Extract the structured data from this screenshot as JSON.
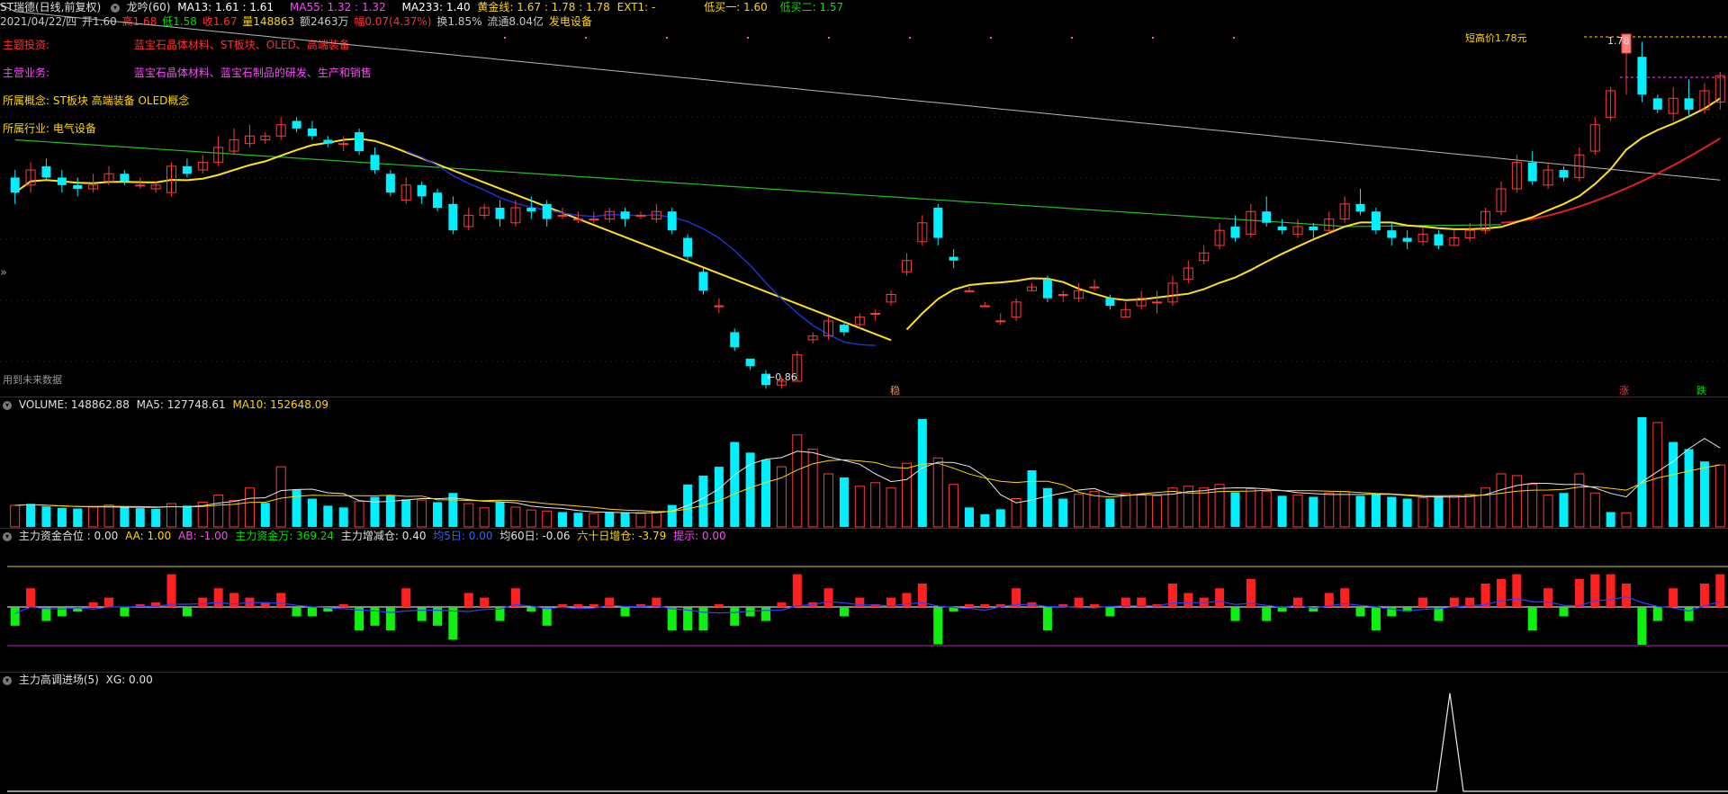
{
  "header": {
    "stock": "ST瑞德(日线,前复权)",
    "indicator": "龙吟(60)",
    "ma13": "MA13: 1.61 : 1.61",
    "ma55": "MA55: 1.32 : 1.32",
    "ma233": "MA233: 1.40",
    "golden_line": "黄金线: 1.67 : 1.78 : 1.78",
    "ext1": "EXT1: -",
    "low_buy1": "低买一: 1.60",
    "low_buy2": "低买二: 1.57",
    "colors": {
      "ma13": "#ffffff",
      "ma55": "#ff44ff",
      "ma233": "#ffffff",
      "golden": "#ffd700",
      "low": "#00e000"
    }
  },
  "quote": {
    "date": "2021/04/22/四",
    "open": "开1.60",
    "high": "高1.68",
    "low": "低1.58",
    "close": "收1.67",
    "volume": "量148863",
    "amount": "额2463万",
    "change": "幅0.07(4.37%)",
    "turnover": "换1.85%",
    "float": "流通8.04亿",
    "industry": "发电设备"
  },
  "info_panel": {
    "theme_label": "主题投资:",
    "theme_value": "蓝宝石晶体材料、ST板块、OLED、高端装备",
    "business_label": "主营业务:",
    "business_value": "蓝宝石晶体材料、蓝宝石制品的研发、生产和销售",
    "concept_label": "所属概念:",
    "concept_value": "ST板块 高端装备 OLED概念",
    "industry_label": "所属行业:",
    "industry_value": "电气设备",
    "top_right_note": "短高价1.78元"
  },
  "chart_labels": {
    "future_data": "用到未来数据",
    "low_price": "←0.86",
    "high_price": "1.78",
    "marker_stable": "稳",
    "marker_up": "涨",
    "marker_down": "跌",
    "collapse": "»"
  },
  "volume_panel": {
    "volume": "VOLUME: 148862.88",
    "ma5": "MA5: 127748.61",
    "ma10": "MA10: 152648.09"
  },
  "fund_panel": {
    "position": "主力资金合位 : 0.00",
    "aa": "AA: 1.00",
    "ab": "AB: -1.00",
    "wan": "主力资金万: 369.24",
    "change": "主力增减仓: 0.40",
    "avg5": "均5日: 0.00",
    "avg60": "均60日: -0.06",
    "sixty": "六十日增仓: -3.79",
    "hint": "提示: 0.00"
  },
  "entry_panel": {
    "title": "主力高调进场(5)",
    "xg": "XG: 0.00"
  },
  "chart_data": {
    "type": "candlestick",
    "series": [
      {
        "name": "K线",
        "values": [
          [
            1.4,
            1.36,
            1.42,
            1.33
          ],
          [
            1.38,
            1.42,
            1.44,
            1.36
          ],
          [
            1.43,
            1.4,
            1.45,
            1.39
          ],
          [
            1.4,
            1.38,
            1.42,
            1.36
          ],
          [
            1.38,
            1.37,
            1.4,
            1.35
          ],
          [
            1.37,
            1.38,
            1.41,
            1.36
          ],
          [
            1.39,
            1.41,
            1.43,
            1.38
          ],
          [
            1.41,
            1.39,
            1.42,
            1.38
          ],
          [
            1.38,
            1.38,
            1.4,
            1.37
          ],
          [
            1.37,
            1.38,
            1.39,
            1.36
          ],
          [
            1.36,
            1.43,
            1.44,
            1.35
          ],
          [
            1.43,
            1.41,
            1.45,
            1.4
          ],
          [
            1.42,
            1.44,
            1.46,
            1.41
          ],
          [
            1.44,
            1.48,
            1.51,
            1.43
          ],
          [
            1.47,
            1.5,
            1.53,
            1.46
          ],
          [
            1.49,
            1.51,
            1.54,
            1.48
          ],
          [
            1.5,
            1.51,
            1.52,
            1.49
          ],
          [
            1.51,
            1.54,
            1.56,
            1.5
          ],
          [
            1.55,
            1.53,
            1.56,
            1.52
          ],
          [
            1.53,
            1.51,
            1.55,
            1.5
          ],
          [
            1.5,
            1.49,
            1.51,
            1.48
          ],
          [
            1.49,
            1.49,
            1.51,
            1.47
          ],
          [
            1.52,
            1.47,
            1.53,
            1.46
          ],
          [
            1.46,
            1.42,
            1.48,
            1.41
          ],
          [
            1.41,
            1.36,
            1.42,
            1.35
          ],
          [
            1.34,
            1.38,
            1.4,
            1.33
          ],
          [
            1.38,
            1.35,
            1.39,
            1.33
          ],
          [
            1.36,
            1.32,
            1.37,
            1.31
          ],
          [
            1.33,
            1.26,
            1.35,
            1.25
          ],
          [
            1.27,
            1.3,
            1.32,
            1.26
          ],
          [
            1.3,
            1.32,
            1.33,
            1.29
          ],
          [
            1.32,
            1.29,
            1.34,
            1.27
          ],
          [
            1.28,
            1.32,
            1.34,
            1.27
          ],
          [
            1.32,
            1.31,
            1.35,
            1.29
          ],
          [
            1.33,
            1.29,
            1.34,
            1.27
          ],
          [
            1.3,
            1.3,
            1.32,
            1.29
          ],
          [
            1.29,
            1.29,
            1.31,
            1.28
          ],
          [
            1.29,
            1.29,
            1.31,
            1.28
          ],
          [
            1.29,
            1.31,
            1.32,
            1.28
          ],
          [
            1.31,
            1.29,
            1.32,
            1.27
          ],
          [
            1.3,
            1.3,
            1.31,
            1.29
          ],
          [
            1.29,
            1.31,
            1.33,
            1.28
          ],
          [
            1.31,
            1.26,
            1.32,
            1.25
          ],
          [
            1.24,
            1.19,
            1.25,
            1.18
          ],
          [
            1.15,
            1.1,
            1.16,
            1.09
          ],
          [
            1.06,
            1.06,
            1.08,
            1.04
          ],
          [
            0.99,
            0.95,
            1.0,
            0.94
          ],
          [
            0.92,
            0.9,
            0.92,
            0.89
          ],
          [
            0.88,
            0.85,
            0.89,
            0.84
          ],
          [
            0.85,
            0.86,
            0.87,
            0.84
          ],
          [
            0.86,
            0.93,
            0.94,
            0.86
          ],
          [
            0.97,
            0.98,
            0.99,
            0.96
          ],
          [
            0.98,
            1.02,
            1.03,
            0.97
          ],
          [
            1.01,
            0.99,
            1.02,
            0.98
          ],
          [
            1.01,
            1.03,
            1.04,
            1.0
          ],
          [
            1.04,
            1.04,
            1.05,
            1.02
          ],
          [
            1.07,
            1.09,
            1.1,
            1.06
          ],
          [
            1.15,
            1.18,
            1.2,
            1.14
          ],
          [
            1.23,
            1.28,
            1.3,
            1.22
          ],
          [
            1.32,
            1.24,
            1.33,
            1.22
          ],
          [
            1.19,
            1.18,
            1.21,
            1.16
          ],
          [
            1.1,
            1.1,
            1.11,
            1.1
          ],
          [
            1.06,
            1.06,
            1.07,
            1.06
          ],
          [
            1.02,
            1.02,
            1.04,
            1.01
          ],
          [
            1.03,
            1.07,
            1.08,
            1.02
          ],
          [
            1.1,
            1.11,
            1.12,
            1.1
          ],
          [
            1.13,
            1.08,
            1.14,
            1.07
          ],
          [
            1.09,
            1.09,
            1.1,
            1.07
          ],
          [
            1.08,
            1.1,
            1.12,
            1.07
          ],
          [
            1.11,
            1.11,
            1.13,
            1.1
          ],
          [
            1.08,
            1.06,
            1.09,
            1.05
          ],
          [
            1.03,
            1.05,
            1.07,
            1.03
          ],
          [
            1.06,
            1.08,
            1.1,
            1.05
          ],
          [
            1.07,
            1.07,
            1.1,
            1.04
          ],
          [
            1.07,
            1.12,
            1.14,
            1.06
          ],
          [
            1.13,
            1.16,
            1.18,
            1.12
          ],
          [
            1.18,
            1.2,
            1.22,
            1.17
          ],
          [
            1.22,
            1.26,
            1.28,
            1.21
          ],
          [
            1.27,
            1.24,
            1.3,
            1.23
          ],
          [
            1.25,
            1.31,
            1.33,
            1.24
          ],
          [
            1.31,
            1.28,
            1.35,
            1.27
          ],
          [
            1.27,
            1.26,
            1.29,
            1.25
          ],
          [
            1.25,
            1.27,
            1.29,
            1.24
          ],
          [
            1.27,
            1.26,
            1.28,
            1.24
          ],
          [
            1.26,
            1.29,
            1.31,
            1.25
          ],
          [
            1.29,
            1.33,
            1.35,
            1.28
          ],
          [
            1.33,
            1.31,
            1.37,
            1.3
          ],
          [
            1.31,
            1.26,
            1.32,
            1.25
          ],
          [
            1.26,
            1.24,
            1.28,
            1.22
          ],
          [
            1.24,
            1.23,
            1.26,
            1.21
          ],
          [
            1.23,
            1.25,
            1.27,
            1.22
          ],
          [
            1.25,
            1.22,
            1.26,
            1.21
          ],
          [
            1.22,
            1.24,
            1.26,
            1.22
          ],
          [
            1.24,
            1.26,
            1.28,
            1.23
          ],
          [
            1.26,
            1.31,
            1.32,
            1.25
          ],
          [
            1.31,
            1.37,
            1.39,
            1.3
          ],
          [
            1.37,
            1.44,
            1.46,
            1.36
          ],
          [
            1.44,
            1.39,
            1.47,
            1.38
          ],
          [
            1.38,
            1.42,
            1.44,
            1.37
          ],
          [
            1.42,
            1.4,
            1.43,
            1.39
          ],
          [
            1.4,
            1.46,
            1.48,
            1.39
          ],
          [
            1.47,
            1.54,
            1.56,
            1.46
          ],
          [
            1.56,
            1.63,
            1.64,
            1.55
          ],
          [
            1.73,
            1.78,
            1.78,
            1.62
          ],
          [
            1.72,
            1.62,
            1.76,
            1.6
          ],
          [
            1.61,
            1.58,
            1.62,
            1.57
          ],
          [
            1.57,
            1.61,
            1.64,
            1.55
          ],
          [
            1.61,
            1.58,
            1.66,
            1.56
          ],
          [
            1.58,
            1.63,
            1.65,
            1.57
          ],
          [
            1.6,
            1.67,
            1.68,
            1.58
          ]
        ]
      }
    ],
    "volumes": [
      [
        61000,
        1
      ],
      [
        65000,
        0
      ],
      [
        58000,
        0
      ],
      [
        54000,
        0
      ],
      [
        52000,
        0
      ],
      [
        56000,
        1
      ],
      [
        62000,
        1
      ],
      [
        55000,
        0
      ],
      [
        53000,
        0
      ],
      [
        51000,
        0
      ],
      [
        66000,
        1
      ],
      [
        60000,
        0
      ],
      [
        70000,
        1
      ],
      [
        90000,
        1
      ],
      [
        75000,
        1
      ],
      [
        110000,
        1
      ],
      [
        68000,
        0
      ],
      [
        170000,
        1
      ],
      [
        105000,
        0
      ],
      [
        80000,
        0
      ],
      [
        60000,
        0
      ],
      [
        55000,
        0
      ],
      [
        72000,
        1
      ],
      [
        85000,
        0
      ],
      [
        90000,
        0
      ],
      [
        78000,
        0
      ],
      [
        76000,
        1
      ],
      [
        70000,
        0
      ],
      [
        96000,
        0
      ],
      [
        66000,
        1
      ],
      [
        54000,
        1
      ],
      [
        70000,
        0
      ],
      [
        56000,
        1
      ],
      [
        48000,
        1
      ],
      [
        45000,
        1
      ],
      [
        42000,
        0
      ],
      [
        40000,
        0
      ],
      [
        38000,
        1
      ],
      [
        42000,
        0
      ],
      [
        40000,
        0
      ],
      [
        38000,
        1
      ],
      [
        42000,
        1
      ],
      [
        62000,
        0
      ],
      [
        120000,
        0
      ],
      [
        145000,
        0
      ],
      [
        170000,
        0
      ],
      [
        240000,
        0
      ],
      [
        210000,
        0
      ],
      [
        190000,
        0
      ],
      [
        170000,
        1
      ],
      [
        260000,
        1
      ],
      [
        220000,
        1
      ],
      [
        150000,
        1
      ],
      [
        140000,
        0
      ],
      [
        115000,
        1
      ],
      [
        125000,
        1
      ],
      [
        110000,
        1
      ],
      [
        180000,
        1
      ],
      [
        305000,
        0
      ],
      [
        195000,
        1
      ],
      [
        120000,
        1
      ],
      [
        55000,
        0
      ],
      [
        36000,
        0
      ],
      [
        50000,
        0
      ],
      [
        80000,
        1
      ],
      [
        160000,
        0
      ],
      [
        110000,
        0
      ],
      [
        80000,
        0
      ],
      [
        92000,
        1
      ],
      [
        100000,
        1
      ],
      [
        80000,
        0
      ],
      [
        95000,
        1
      ],
      [
        90000,
        1
      ],
      [
        88000,
        1
      ],
      [
        110000,
        1
      ],
      [
        115000,
        1
      ],
      [
        110000,
        1
      ],
      [
        120000,
        1
      ],
      [
        98000,
        0
      ],
      [
        108000,
        1
      ],
      [
        100000,
        1
      ],
      [
        88000,
        0
      ],
      [
        90000,
        1
      ],
      [
        85000,
        0
      ],
      [
        96000,
        1
      ],
      [
        100000,
        1
      ],
      [
        88000,
        0
      ],
      [
        92000,
        0
      ],
      [
        85000,
        0
      ],
      [
        80000,
        0
      ],
      [
        82000,
        1
      ],
      [
        86000,
        0
      ],
      [
        88000,
        1
      ],
      [
        92000,
        1
      ],
      [
        110000,
        1
      ],
      [
        150000,
        1
      ],
      [
        145000,
        1
      ],
      [
        120000,
        1
      ],
      [
        90000,
        1
      ],
      [
        96000,
        0
      ],
      [
        150000,
        1
      ],
      [
        96000,
        1
      ],
      [
        42000,
        0
      ],
      [
        40000,
        1
      ],
      [
        310000,
        0
      ],
      [
        295000,
        1
      ],
      [
        240000,
        0
      ],
      [
        220000,
        0
      ],
      [
        185000,
        0
      ],
      [
        175000,
        1
      ]
    ]
  }
}
